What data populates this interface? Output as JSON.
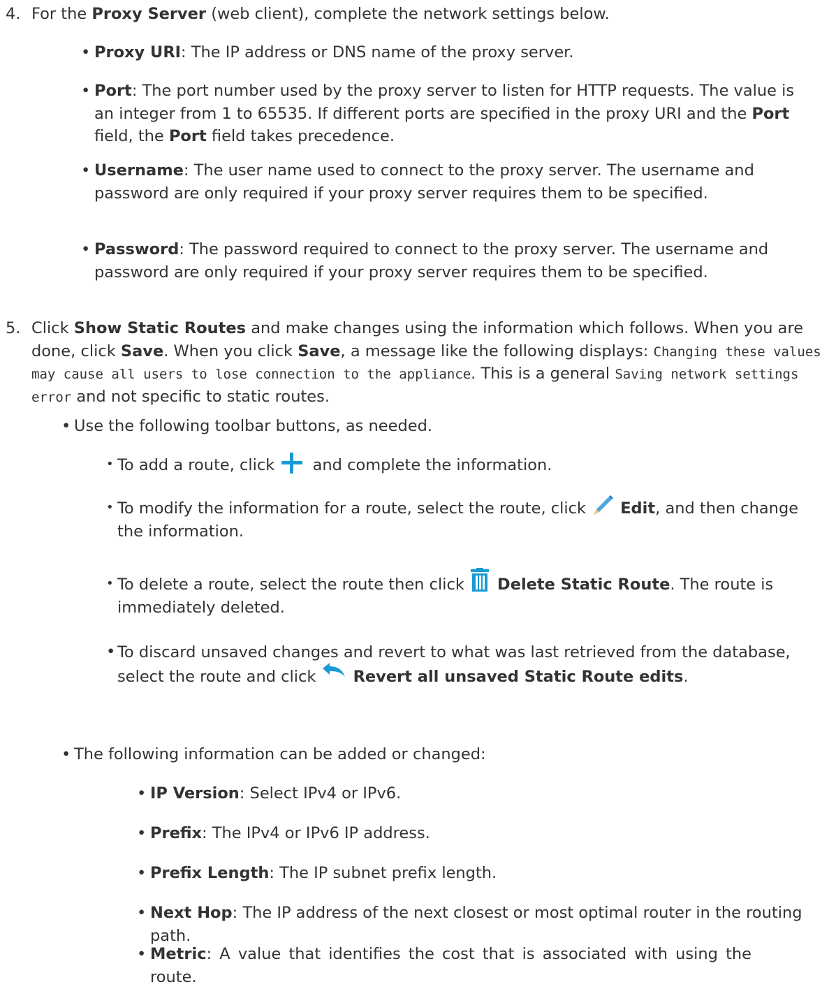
{
  "step4": {
    "num": "4.",
    "t1": "For the ",
    "b1": "Proxy Server",
    "t2": " (web client), complete the network settings below.",
    "items": [
      {
        "label": "Proxy URI",
        "text": ": The IP address or DNS name of the proxy server."
      },
      {
        "label": "Port",
        "text_a": ": The port number used by the proxy server to listen for HTTP requests. The value is an integer from 1 to 65535. If different ports are specified in the proxy URI and the ",
        "b2": "Port",
        "text_b": " field, the ",
        "b3": "Port",
        "text_c": " field takes precedence."
      },
      {
        "label": "Username",
        "text": ": The user name used to connect to the proxy server. The username and password are only required if your proxy server requires them to be specified."
      },
      {
        "label": "Password",
        "text": ": The password required to connect to the proxy server. The username and password are only required if your proxy server requires them to be specified."
      }
    ]
  },
  "step5": {
    "num": "5.",
    "t1": "Click ",
    "b1": "Show Static Routes",
    "t2": " and make changes using the information which follows. When you are done, click ",
    "b2": "Save",
    "t3": ". When you click ",
    "b3": "Save",
    "t4": ", a message like the following displays: ",
    "code1": "Changing these values may cause all users to lose connection to the appliance",
    "t5": ". This is a general ",
    "code2": "Saving network settings error",
    "t6": " and not specific to static routes.",
    "toolbar_intro": "Use the following toolbar buttons, as needed.",
    "add": {
      "t1": "To add a route, click ",
      "t2": " and complete the information.",
      "icon": "plus-icon"
    },
    "edit": {
      "t1": "To modify the information for a route, select the route, click ",
      "b": "Edit",
      "t2": ", and then change the information.",
      "icon": "pencil-icon"
    },
    "del": {
      "t1": "To delete a route, select the route then click ",
      "b": "Delete Static Route",
      "t2": ". The route is immediately deleted.",
      "icon": "trash-icon"
    },
    "revert": {
      "t1": "To discard unsaved changes and revert to what was last retrieved from the database, select the route and click ",
      "b": "Revert all unsaved Static Route edits",
      "t2": ".",
      "icon": "undo-arrow-icon"
    },
    "info_intro": "The following information can be added or changed:",
    "fields": [
      {
        "label": "IP Version",
        "text": ": Select IPv4 or IPv6."
      },
      {
        "label": "Prefix",
        "text": ": The IPv4 or IPv6 IP address."
      },
      {
        "label": "Prefix Length",
        "text": ": The IP subnet prefix length."
      },
      {
        "label": "Next Hop",
        "text": ": The IP address of the next closest or most optimal router in the routing path."
      },
      {
        "label": "Metric",
        "text": ": A value that identifies the cost that is associated with using the route."
      }
    ]
  },
  "colors": {
    "text": "#333333",
    "icon_blue": "#1a9ad6"
  }
}
